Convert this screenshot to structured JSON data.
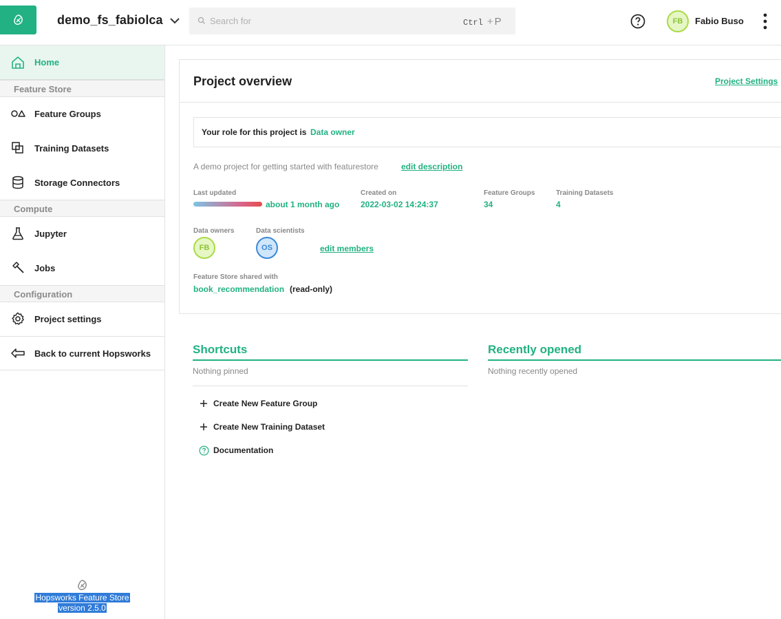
{
  "header": {
    "project_name": "demo_fs_fabiolca",
    "search_placeholder": "Search for",
    "shortcut_key1": "Ctrl",
    "shortcut_plus": "+",
    "shortcut_key2": "P",
    "user_initials": "FB",
    "user_name": "Fabio Buso"
  },
  "sidebar": {
    "home": "Home",
    "sections": {
      "feature_store": "Feature Store",
      "compute": "Compute",
      "configuration": "Configuration"
    },
    "items": {
      "feature_groups": "Feature Groups",
      "training_datasets": "Training Datasets",
      "storage_connectors": "Storage Connectors",
      "jupyter": "Jupyter",
      "jobs": "Jobs",
      "project_settings": "Project settings",
      "back": "Back to current Hopsworks"
    },
    "footer_line1": "Hopsworks Feature Store",
    "footer_line2": "version 2.5.0"
  },
  "overview": {
    "title": "Project overview",
    "settings_link": "Project Settings",
    "role_label": "Your role for this project is",
    "role_value": "Data owner",
    "description": "A demo project for getting started with featurestore",
    "edit_description": "edit description",
    "last_updated_label": "Last updated",
    "last_updated_value": "about 1 month ago",
    "created_label": "Created on",
    "created_value": "2022-03-02 14:24:37",
    "feature_groups_label": "Feature Groups",
    "feature_groups_value": "34",
    "training_datasets_label": "Training Datasets",
    "training_datasets_value": "4",
    "data_owners_label": "Data owners",
    "data_owner_initials": "FB",
    "data_scientists_label": "Data scientists",
    "data_scientist_initials": "OS",
    "edit_members": "edit members",
    "shared_label": "Feature Store shared with",
    "shared_value": "book_recommendation",
    "shared_mode": "(read-only)"
  },
  "shortcuts": {
    "title": "Shortcuts",
    "empty": "Nothing pinned",
    "items": [
      "Create New Feature Group",
      "Create New Training Dataset",
      "Documentation"
    ]
  },
  "recent": {
    "title": "Recently opened",
    "empty": "Nothing recently opened"
  },
  "colors": {
    "accent": "#21b182",
    "selection": "#2f7bd9"
  }
}
